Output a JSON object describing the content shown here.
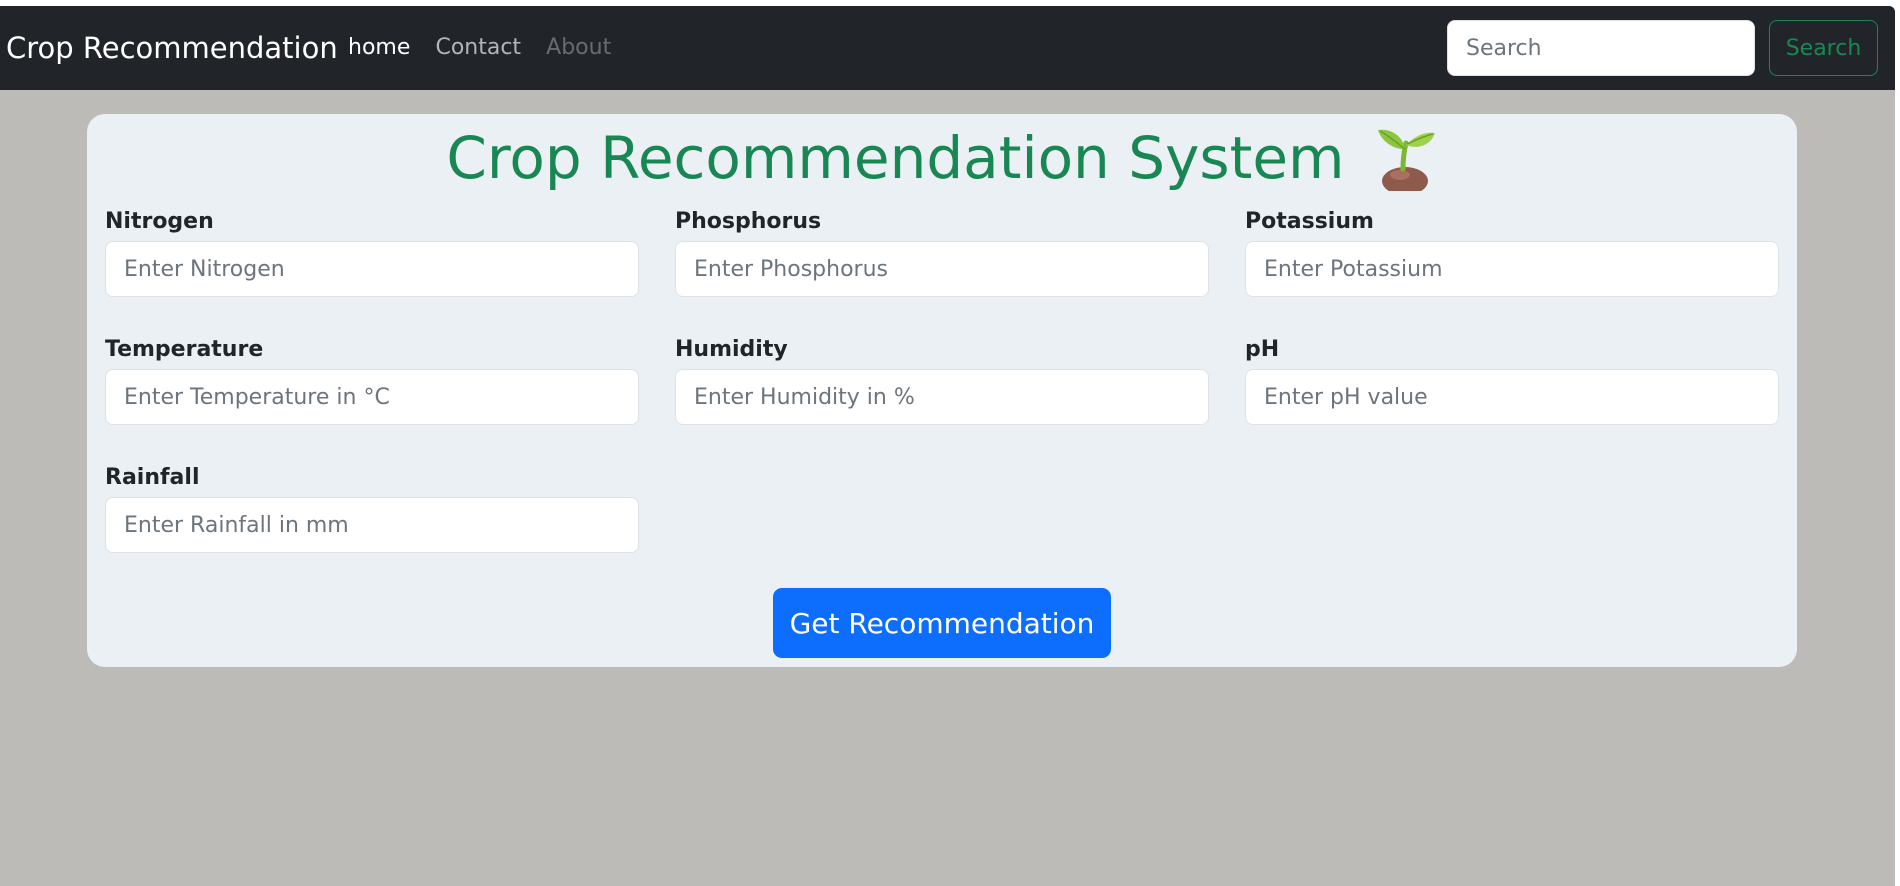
{
  "navbar": {
    "brand": "Crop Recommendation",
    "links": [
      {
        "label": "home"
      },
      {
        "label": "Contact"
      },
      {
        "label": "About"
      }
    ],
    "search": {
      "placeholder": "Search",
      "button_label": "Search"
    }
  },
  "form": {
    "title": "Crop Recommendation System",
    "title_icon": "seedling-icon",
    "fields": [
      {
        "label": "Nitrogen",
        "placeholder": "Enter Nitrogen",
        "value": ""
      },
      {
        "label": "Phosphorus",
        "placeholder": "Enter Phosphorus",
        "value": ""
      },
      {
        "label": "Potassium",
        "placeholder": "Enter Potassium",
        "value": ""
      },
      {
        "label": "Temperature",
        "placeholder": "Enter Temperature in °C",
        "value": ""
      },
      {
        "label": "Humidity",
        "placeholder": "Enter Humidity in %",
        "value": ""
      },
      {
        "label": "pH",
        "placeholder": "Enter pH value",
        "value": ""
      },
      {
        "label": "Rainfall",
        "placeholder": "Enter Rainfall in mm",
        "value": ""
      }
    ],
    "submit_label": "Get Recommendation"
  },
  "colors": {
    "navbar_bg": "#212529",
    "page_bg": "#bcbbb7",
    "card_bg": "#ebf0f4",
    "title": "#198754",
    "primary": "#0d6efd",
    "search_outline": "#198754"
  }
}
